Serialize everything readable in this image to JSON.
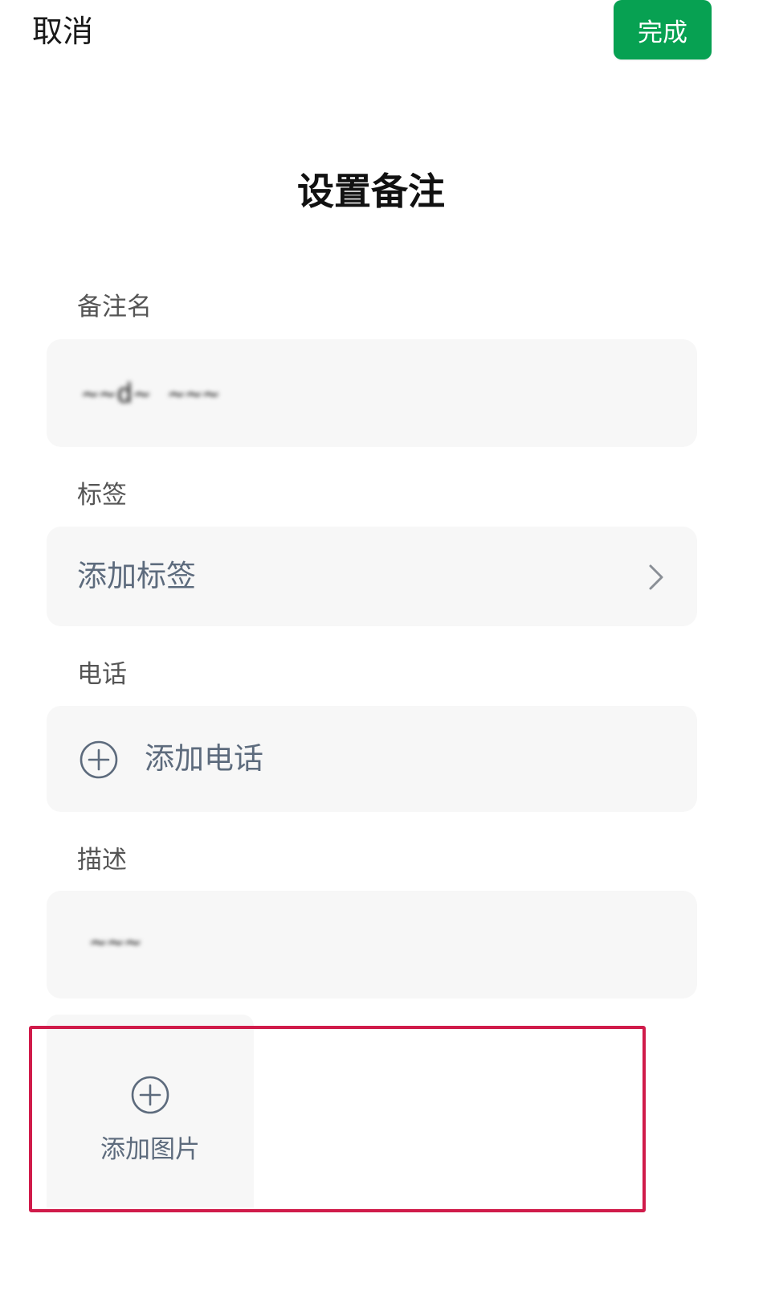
{
  "header": {
    "cancel_label": "取消",
    "done_label": "完成"
  },
  "page": {
    "title": "设置备注"
  },
  "remark": {
    "label": "备注名",
    "value": "~~d~ ~~~"
  },
  "tags": {
    "label": "标签",
    "action_label": "添加标签"
  },
  "phone": {
    "label": "电话",
    "action_label": "添加电话"
  },
  "description": {
    "label": "描述",
    "value": "~~~"
  },
  "photo": {
    "action_label": "添加图片"
  },
  "colors": {
    "accent": "#07a152",
    "highlight": "#d01b4a",
    "card_bg": "#f7f7f7",
    "action_text": "#5d6b7d"
  },
  "icons": {
    "tag_chevron": "chevron-right-icon",
    "phone_add": "plus-circle-icon",
    "photo_add": "plus-circle-icon"
  }
}
